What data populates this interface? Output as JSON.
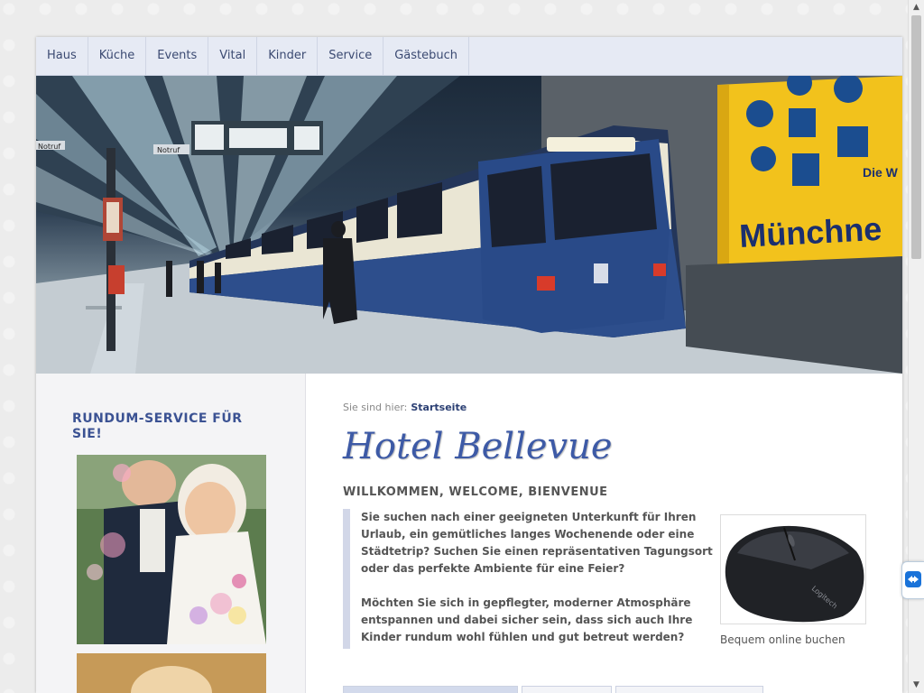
{
  "nav": {
    "items": [
      "Haus",
      "Küche",
      "Events",
      "Vital",
      "Kinder",
      "Service",
      "Gästebuch"
    ]
  },
  "hero": {
    "sign_left": "Notruf",
    "sign_center": "Notruf",
    "ad_text_1": "Die W",
    "ad_text_2": "Münchne"
  },
  "sidebar": {
    "title": "RUNDUM-SERVICE FÜR SIE!"
  },
  "main": {
    "breadcrumb_prefix": "Sie sind hier:",
    "breadcrumb_link": "Startseite",
    "site_title": "Hotel Bellevue",
    "subheading": "WILLKOMMEN, WELCOME, BIENVENUE",
    "paragraph1": "Sie suchen nach einer geeigneten Unterkunft für Ihren Urlaub, ein gemütliches langes Wochenende oder eine Städtetrip? Suchen Sie einen repräsentativen Tagungsort oder das perfekte Ambiente für eine Feier?",
    "paragraph2": "Möchten Sie sich in gepflegter, moderner Atmosphäre entspannen und dabei sicher sein, dass sich auch Ihre Kinder rundum wohl fühlen und gut betreut werden?",
    "booking_label": "Bequem online buchen",
    "mouse_brand": "Logitech"
  },
  "colors": {
    "accent": "#3b5293",
    "nav_bg": "#e6eaf4",
    "title": "#3d5aa6"
  },
  "icons": {
    "scroll_up": "▲",
    "scroll_down": "▼"
  }
}
